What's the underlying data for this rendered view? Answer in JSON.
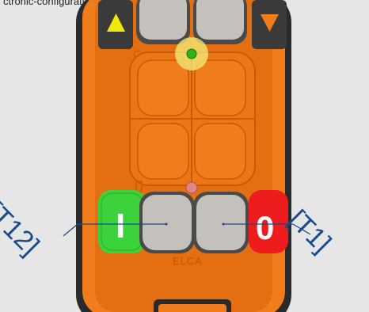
{
  "caption": "ctronic-configuration-preview-description",
  "device": {
    "brand": "ELCA",
    "colors": {
      "shell": "#f07c1c",
      "shell_dark": "#c85a06",
      "frame": "#2a2a2a",
      "button_grey": "#c4c0bb",
      "on_button": "#3cd23c",
      "off_button": "#ee1c1c",
      "led_green": "#2bb51c",
      "led_red": "#e08787",
      "arrow_up": "#f1e80a",
      "arrow_down": "#f07c1c"
    },
    "buttons": {
      "on_label": "I",
      "off_label": "0"
    },
    "callouts": {
      "left": "[T12]",
      "right": "[T1]"
    }
  }
}
